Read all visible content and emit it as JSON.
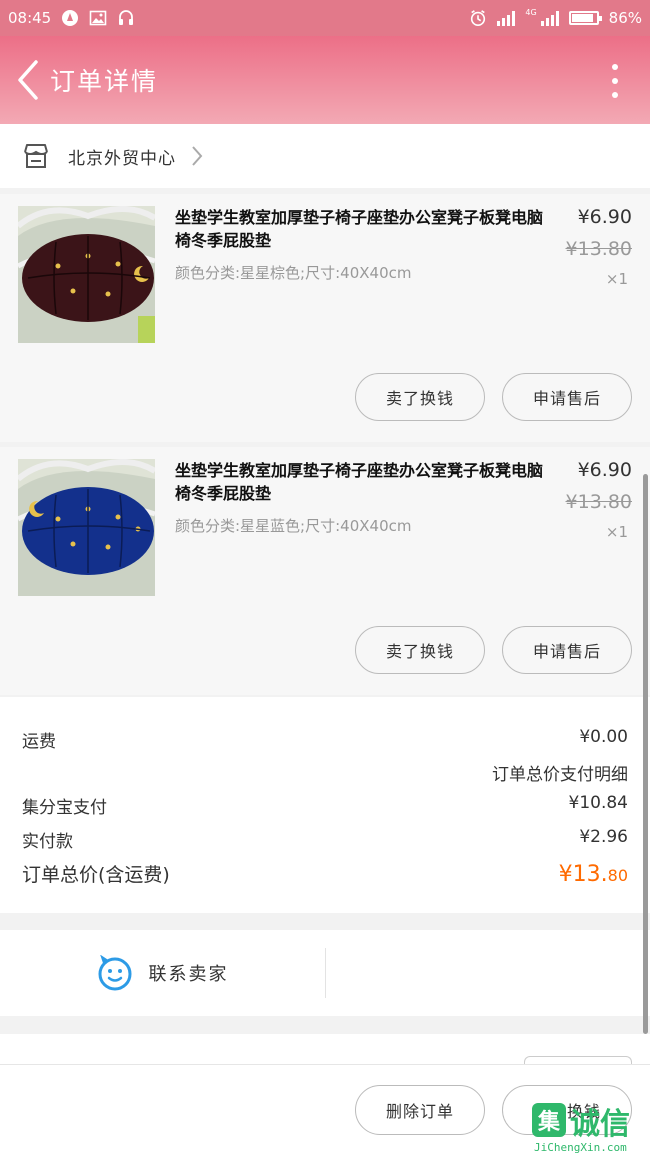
{
  "status_bar": {
    "time": "08:45",
    "network_label": "4G",
    "battery_percent": "86%",
    "battery_level": 0.86
  },
  "header": {
    "title": "订单详情"
  },
  "store": {
    "name": "北京外贸中心"
  },
  "items": [
    {
      "title": "坐垫学生教室加厚垫子椅子座垫办公室凳子板凳电脑椅冬季屁股垫",
      "spec": "颜色分类:星星棕色;尺寸:40X40cm",
      "price": "¥6.90",
      "original_price": "¥13.80",
      "quantity": "×1",
      "cushion_color": "#3b1418",
      "sell_label": "卖了换钱",
      "after_sale_label": "申请售后"
    },
    {
      "title": "坐垫学生教室加厚垫子椅子座垫办公室凳子板凳电脑椅冬季屁股垫",
      "spec": "颜色分类:星星蓝色;尺寸:40X40cm",
      "price": "¥6.90",
      "original_price": "¥13.80",
      "quantity": "×1",
      "cushion_color": "#13308c",
      "sell_label": "卖了换钱",
      "after_sale_label": "申请售后"
    }
  ],
  "summary": {
    "shipping_label": "运费",
    "shipping_value": "¥0.00",
    "breakdown_link": "订单总价支付明细",
    "points_label": "集分宝支付",
    "points_value": "¥10.84",
    "paid_label": "实付款",
    "paid_value": "¥2.96",
    "total_label": "订单总价(含运费)",
    "total_value_main": "¥13.",
    "total_value_small": "80"
  },
  "contact": {
    "label": "联系卖家"
  },
  "bottom_bar": {
    "delete_label": "删除订单",
    "sell_label": "卖了换钱"
  },
  "watermark": {
    "badge": "集",
    "text": "诚信",
    "url": "JiChengXin.com"
  },
  "colors": {
    "header_gradient_top": "#ec6f87",
    "header_gradient_bottom": "#f3a9b4",
    "price_accent": "#ff6a00",
    "chat_icon_blue": "#2d9be6"
  }
}
